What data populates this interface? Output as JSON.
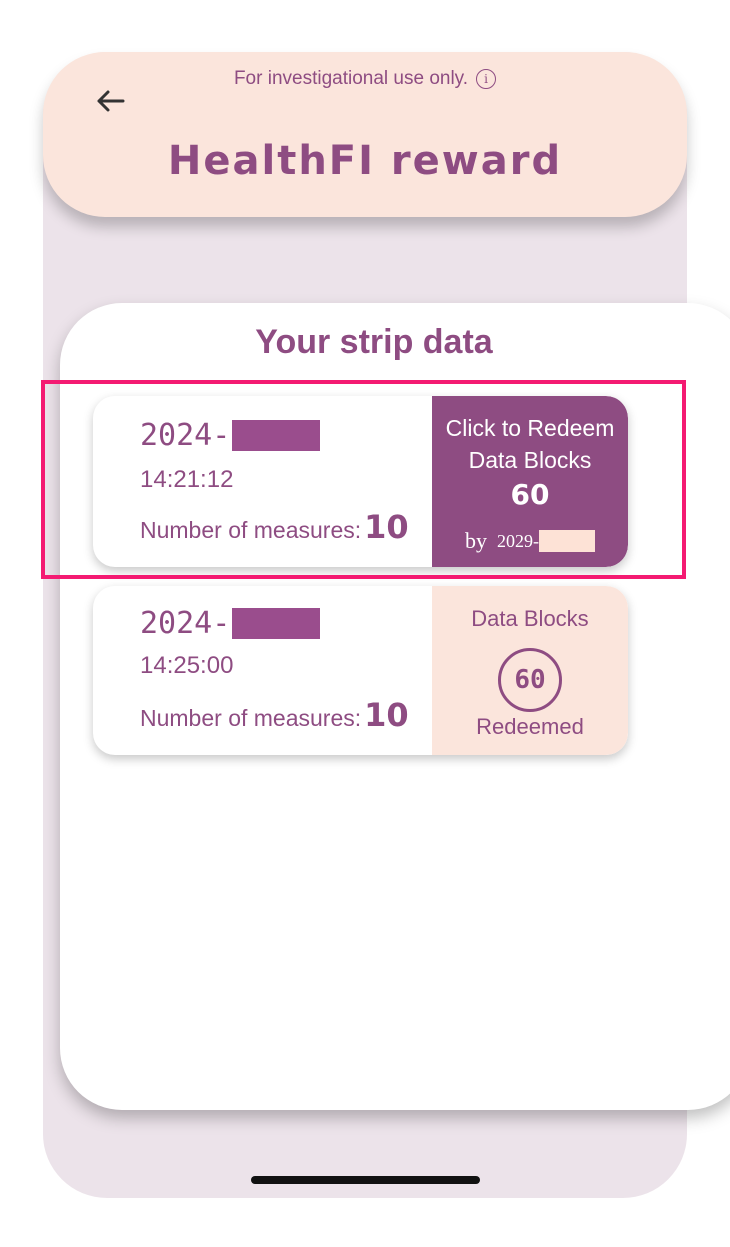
{
  "header": {
    "disclaimer": "For investigational use only.",
    "info_glyph": "i",
    "title": "HealthFI reward",
    "back_icon": "arrow-left-icon"
  },
  "section": {
    "title": "Your strip data"
  },
  "cards": [
    {
      "date_prefix": "2024-",
      "time": "14:21:12",
      "measures_label": "Number of measures:",
      "measures_value": "10",
      "action": {
        "line1": "Click to Redeem",
        "line2": "Data Blocks",
        "value": "60",
        "by_label": "by",
        "by_date_prefix": "2029-"
      },
      "highlighted": true
    },
    {
      "date_prefix": "2024-",
      "time": "14:25:00",
      "measures_label": "Number of measures:",
      "measures_value": "10",
      "status": {
        "label": "Data Blocks",
        "value": "60",
        "state": "Redeemed"
      }
    }
  ],
  "colors": {
    "accent": "#8e4c82",
    "header_bg": "#fbe5dc",
    "highlight": "#f41a72",
    "phone_bg": "#ece3ea"
  }
}
